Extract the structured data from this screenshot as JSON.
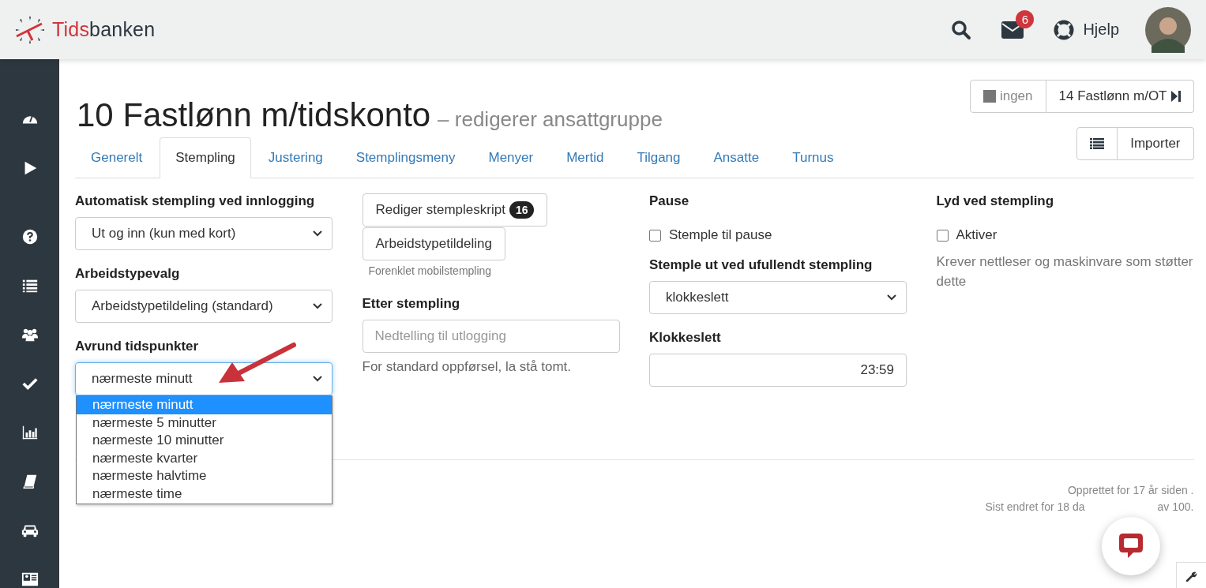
{
  "header": {
    "logo": {
      "part_1": "Tids",
      "part_2": "banken"
    },
    "messages_badge": "6",
    "help": "Hjelp"
  },
  "page": {
    "title": "10 Fastlønn m/tidskonto",
    "subtitle": "– redigerer ansattgruppe"
  },
  "nav": {
    "previous": "ingen",
    "next": "14 Fastlønn m/OT",
    "import": "Importer"
  },
  "tabs": [
    {
      "label": "Generelt",
      "selected": false
    },
    {
      "label": "Stempling",
      "selected": true
    },
    {
      "label": "Justering",
      "selected": false
    },
    {
      "label": "Stemplingsmeny",
      "selected": false
    },
    {
      "label": "Menyer",
      "selected": false
    },
    {
      "label": "Mertid",
      "selected": false
    },
    {
      "label": "Tilgang",
      "selected": false
    },
    {
      "label": "Ansatte",
      "selected": false
    },
    {
      "label": "Turnus",
      "selected": false
    }
  ],
  "columns": [
    {
      "fields": [
        {
          "kind": "heading",
          "text": "Automatisk stempling ved innlogging"
        },
        {
          "kind": "select",
          "value": "Ut og inn (kun med kort)",
          "focused": false,
          "open": false
        },
        {
          "kind": "heading",
          "text": "Arbeidstypevalg"
        },
        {
          "kind": "select",
          "value": "Arbeidstypetildeling (standard)",
          "focused": false,
          "open": false
        },
        {
          "kind": "heading",
          "text": "Avrund tidspunkter"
        },
        {
          "kind": "select",
          "value": "nærmeste minutt",
          "focused": true,
          "open": true,
          "options": [
            {
              "label": "nærmeste minutt",
              "selected": true
            },
            {
              "label": "nærmeste 5 minutter",
              "selected": false
            },
            {
              "label": "nærmeste 10 minutter",
              "selected": false
            },
            {
              "label": "nærmeste kvarter",
              "selected": false
            },
            {
              "label": "nærmeste halvtime",
              "selected": false
            },
            {
              "label": "nærmeste time",
              "selected": false
            }
          ]
        }
      ]
    },
    {
      "fields": [
        {
          "kind": "button",
          "text": "Rediger stempleskript",
          "badge": "16"
        },
        {
          "kind": "button",
          "text": "Arbeidstypetildeling"
        },
        {
          "kind": "hint",
          "text": "Forenklet mobilstempling"
        },
        {
          "kind": "heading",
          "text": "Etter stempling"
        },
        {
          "kind": "text_input",
          "placeholder": "Nedtelling til utlogging"
        },
        {
          "kind": "help",
          "text": "For standard oppførsel, la stå tomt."
        }
      ]
    },
    {
      "fields": [
        {
          "kind": "heading",
          "text": "Pause"
        },
        {
          "kind": "checkbox",
          "text": "Stemple til pause",
          "checked": false
        },
        {
          "kind": "heading",
          "text": "Stemple ut ved ufullendt stempling"
        },
        {
          "kind": "select",
          "value": "klokkeslett",
          "focused": false,
          "open": false
        },
        {
          "kind": "heading",
          "text": "Klokkeslett"
        },
        {
          "kind": "time_input",
          "value": "23:59"
        }
      ]
    },
    {
      "fields": [
        {
          "kind": "heading",
          "text": "Lyd ved stempling"
        },
        {
          "kind": "checkbox",
          "text": "Aktiver",
          "checked": false
        },
        {
          "kind": "note",
          "text": "Krever nettleser og maskinvare som støtter dette"
        }
      ]
    }
  ],
  "footer": {
    "created": "Opprettet for 17 år siden .",
    "changed_start": "Sist endret for 18 da",
    "changed_end": "av 100."
  }
}
